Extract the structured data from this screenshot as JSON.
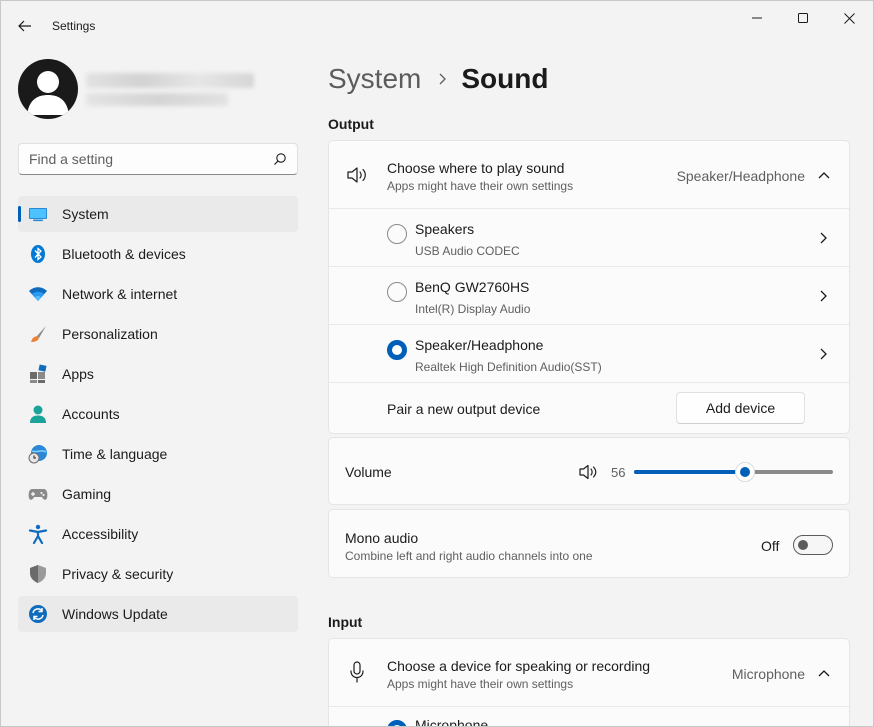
{
  "window": {
    "app_title": "Settings"
  },
  "search": {
    "placeholder": "Find a setting"
  },
  "sidebar": {
    "items": [
      {
        "label": "System",
        "icon": "system-icon"
      },
      {
        "label": "Bluetooth & devices",
        "icon": "bluetooth-icon"
      },
      {
        "label": "Network & internet",
        "icon": "wifi-icon"
      },
      {
        "label": "Personalization",
        "icon": "brush-icon"
      },
      {
        "label": "Apps",
        "icon": "apps-icon"
      },
      {
        "label": "Accounts",
        "icon": "person-icon"
      },
      {
        "label": "Time & language",
        "icon": "globe-clock-icon"
      },
      {
        "label": "Gaming",
        "icon": "gamepad-icon"
      },
      {
        "label": "Accessibility",
        "icon": "accessibility-icon"
      },
      {
        "label": "Privacy & security",
        "icon": "shield-icon"
      },
      {
        "label": "Windows Update",
        "icon": "update-icon"
      }
    ],
    "selected": "System"
  },
  "breadcrumb": {
    "parent": "System",
    "current": "Sound"
  },
  "output": {
    "section_title": "Output",
    "choose_title": "Choose where to play sound",
    "choose_sub": "Apps might have their own settings",
    "choose_value": "Speaker/Headphone",
    "devices": [
      {
        "name": "Speakers",
        "detail": "USB Audio CODEC",
        "selected": false
      },
      {
        "name": "BenQ GW2760HS",
        "detail": "Intel(R) Display Audio",
        "selected": false
      },
      {
        "name": "Speaker/Headphone",
        "detail": "Realtek High Definition Audio(SST)",
        "selected": true
      }
    ],
    "pair_label": "Pair a new output device",
    "add_device_label": "Add device"
  },
  "volume": {
    "label": "Volume",
    "value": "56",
    "fraction": 0.56
  },
  "mono": {
    "title": "Mono audio",
    "subtitle": "Combine left and right audio channels into one",
    "state_label": "Off"
  },
  "input": {
    "section_title": "Input",
    "choose_title": "Choose a device for speaking or recording",
    "choose_sub": "Apps might have their own settings",
    "choose_value": "Microphone",
    "first_device": "Microphone"
  },
  "colors": {
    "accent": "#005fb8",
    "background": "#f3f3f3",
    "card": "#fbfbfb"
  }
}
